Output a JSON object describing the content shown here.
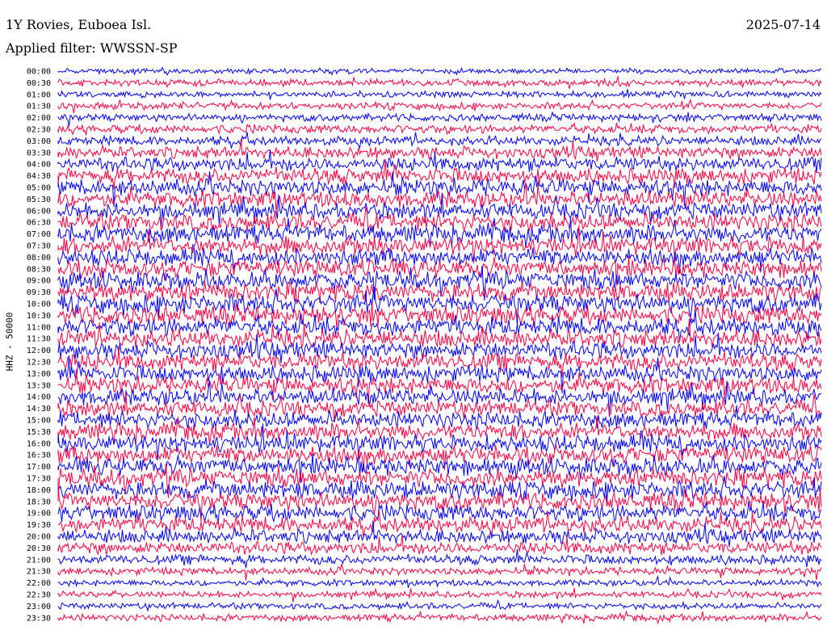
{
  "header": {
    "station": "1Y Rovies, Euboea Isl.",
    "filter_label": "Applied filter:",
    "filter_name": "WWSSN-SP",
    "date": "2025-07-14"
  },
  "chart_data": {
    "type": "line",
    "title": "1Y Rovies, Euboea Isl.",
    "subtitle": "Applied filter: WWSSN-SP",
    "date": "2025-07-14",
    "ylabel": "HHZ - 50000",
    "xlabel": "",
    "row_labels": [
      "00:00",
      "00:30",
      "01:00",
      "01:30",
      "02:00",
      "02:30",
      "03:00",
      "03:30",
      "04:00",
      "04:30",
      "05:00",
      "05:30",
      "06:00",
      "06:30",
      "07:00",
      "07:30",
      "08:00",
      "08:30",
      "09:00",
      "09:30",
      "10:00",
      "10:30",
      "11:00",
      "11:30",
      "12:00",
      "12:30",
      "13:00",
      "13:30",
      "14:00",
      "14:30",
      "15:00",
      "15:30",
      "16:00",
      "16:30",
      "17:00",
      "17:30",
      "18:00",
      "18:30",
      "19:00",
      "19:30",
      "20:00",
      "20:30",
      "21:00",
      "21:30",
      "22:00",
      "22:30",
      "23:00",
      "23:30"
    ],
    "row_amplitude": [
      0.4,
      0.55,
      0.5,
      0.55,
      0.6,
      0.7,
      0.75,
      0.95,
      1.1,
      1.2,
      1.3,
      1.3,
      1.3,
      1.35,
      1.4,
      1.4,
      1.35,
      1.4,
      1.4,
      1.45,
      1.5,
      1.45,
      1.45,
      1.4,
      1.35,
      1.35,
      1.3,
      1.3,
      1.3,
      1.25,
      1.3,
      1.3,
      1.35,
      1.35,
      1.4,
      1.4,
      1.4,
      1.4,
      1.3,
      1.25,
      1.1,
      1.0,
      0.75,
      0.6,
      0.5,
      0.5,
      0.5,
      0.55
    ],
    "series_colors": [
      "#0000ff",
      "#ff0040"
    ],
    "grid": false,
    "legend": "none"
  }
}
